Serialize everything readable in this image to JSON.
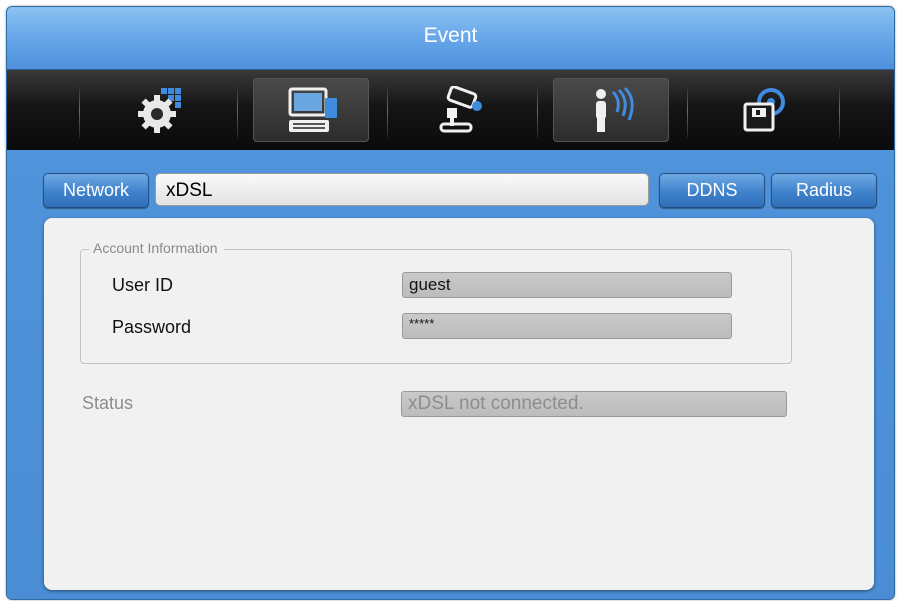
{
  "title": "Event",
  "toolbar_icons": [
    {
      "icon": "system-settings-icon",
      "active": false
    },
    {
      "icon": "network-computer-icon",
      "active": true
    },
    {
      "icon": "ptz-camera-icon",
      "active": false
    },
    {
      "icon": "event-person-icon",
      "active": true
    },
    {
      "icon": "storage-disk-icon",
      "active": false
    }
  ],
  "tabs": {
    "network": "Network",
    "current": "xDSL",
    "ddns": "DDNS",
    "radius": "Radius"
  },
  "account": {
    "legend": "Account Information",
    "user_id_label": "User ID",
    "user_id_value": "guest",
    "password_label": "Password",
    "password_value": "*****"
  },
  "status": {
    "label": "Status",
    "value": "xDSL not connected."
  },
  "colors": {
    "title_bar": "#6aa9ea",
    "tab_button": "#3f82cc",
    "panel": "#f1f1f1",
    "icon_bar": "#151515"
  }
}
